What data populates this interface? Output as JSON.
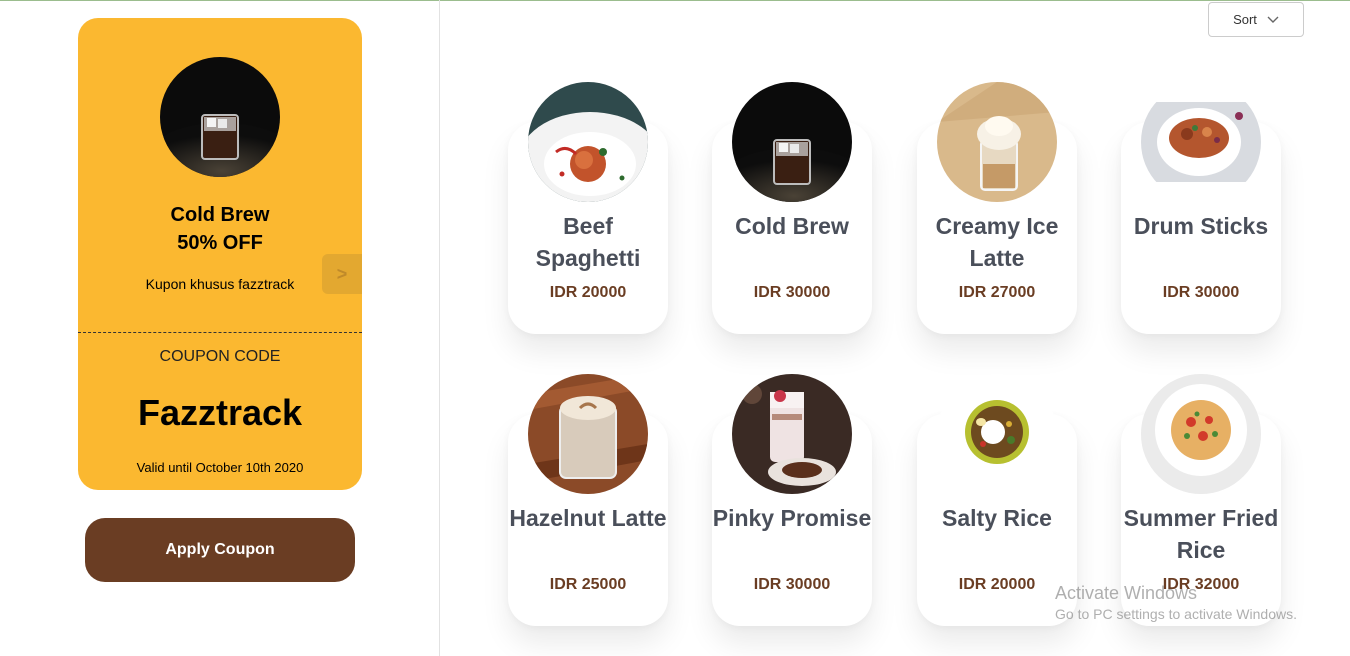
{
  "coupon": {
    "title_line1": "Cold Brew",
    "title_line2": "50% OFF",
    "description": "Kupon khusus fazztrack",
    "next_label": ">",
    "code_label": "COUPON CODE",
    "code": "Fazztrack",
    "valid": "Valid until October 10th 2020",
    "color": "#fbb830"
  },
  "apply_button": "Apply Coupon",
  "sort": {
    "label": "Sort",
    "icon": "chevron-down-icon"
  },
  "products": [
    {
      "name": "Beef Spaghetti",
      "price": "IDR 20000"
    },
    {
      "name": "Cold Brew",
      "price": "IDR 30000"
    },
    {
      "name": "Creamy Ice Latte",
      "price": "IDR 27000"
    },
    {
      "name": "Drum Sticks",
      "price": "IDR 30000"
    },
    {
      "name": "Hazelnut Latte",
      "price": "IDR 25000"
    },
    {
      "name": "Pinky Promise",
      "price": "IDR 30000"
    },
    {
      "name": "Salty Rice",
      "price": "IDR 20000"
    },
    {
      "name": "Summer Fried Rice",
      "price": "IDR 32000"
    }
  ],
  "watermark": {
    "line1": "Activate Windows",
    "line2": "Go to PC settings to activate Windows."
  },
  "colors": {
    "brown": "#6a3d23",
    "accent": "#fbb830"
  }
}
